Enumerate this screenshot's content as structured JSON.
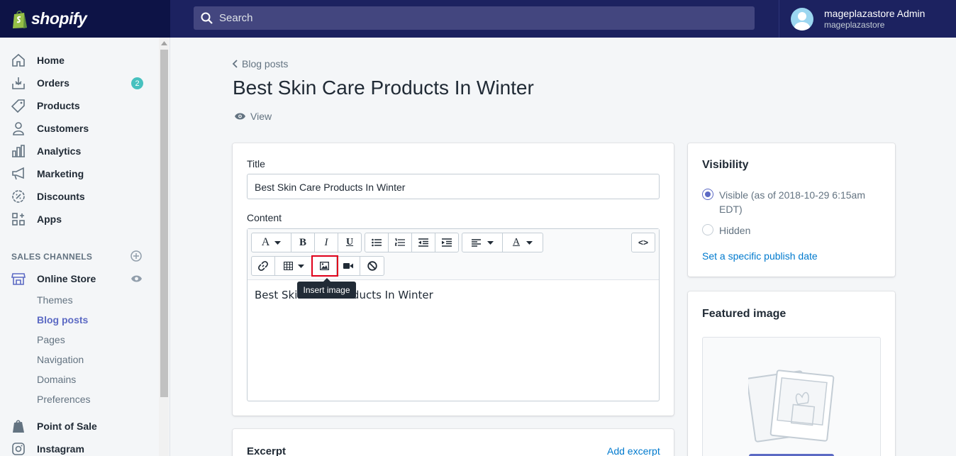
{
  "brand": {
    "name": "shopify"
  },
  "search": {
    "label": "Search"
  },
  "account": {
    "name": "mageplazastore Admin",
    "store": "mageplazastore"
  },
  "sidebar": {
    "items": [
      {
        "label": "Home",
        "icon": "home-icon"
      },
      {
        "label": "Orders",
        "icon": "orders-icon",
        "badge": "2"
      },
      {
        "label": "Products",
        "icon": "tag-icon"
      },
      {
        "label": "Customers",
        "icon": "person-icon"
      },
      {
        "label": "Analytics",
        "icon": "bar-chart-icon"
      },
      {
        "label": "Marketing",
        "icon": "megaphone-icon"
      },
      {
        "label": "Discounts",
        "icon": "discount-icon"
      },
      {
        "label": "Apps",
        "icon": "apps-icon"
      }
    ],
    "sales_channels": "SALES CHANNELS",
    "online_store": "Online Store",
    "subitems": [
      "Themes",
      "Blog posts",
      "Pages",
      "Navigation",
      "Domains",
      "Preferences"
    ],
    "active_subitem": "Blog posts",
    "point_of_sale": "Point of Sale",
    "instagram": "Instagram"
  },
  "main": {
    "breadcrumb": "Blog posts",
    "title": "Best Skin Care Products In Winter",
    "view": "View"
  },
  "form": {
    "title_label": "Title",
    "title_value": "Best Skin Care Products In Winter",
    "content_label": "Content",
    "content_text": "Best Skin Care Products In Winter",
    "tooltip": "Insert image",
    "code_label": "<>",
    "excerpt_label": "Excerpt",
    "add_excerpt": "Add excerpt"
  },
  "visibility": {
    "title": "Visibility",
    "visible_label": "Visible (as of 2018-10-29 6:15am EDT)",
    "hidden_label": "Hidden",
    "publish_link": "Set a specific publish date",
    "selected": "visible"
  },
  "featured": {
    "title": "Featured image"
  },
  "colors": {
    "accent": "#5c6ac4",
    "topbar": "#1c2260",
    "link": "#007ace",
    "highlight": "#e0001b"
  }
}
